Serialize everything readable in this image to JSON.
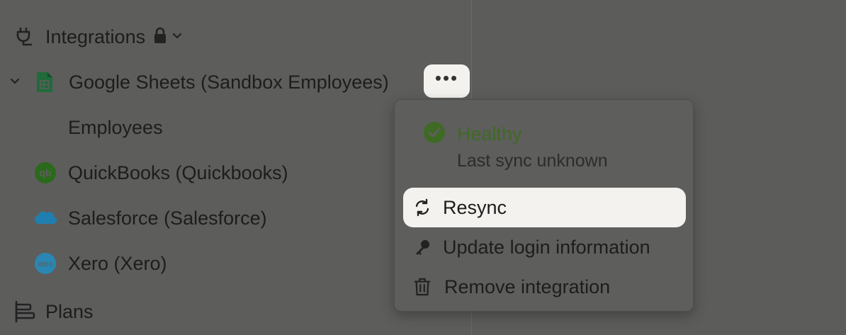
{
  "sidebar": {
    "integrations": {
      "label": "Integrations",
      "icon": "plug-icon"
    },
    "items": [
      {
        "label": "Google Sheets (Sandbox Employees)",
        "icon": "google-sheets-icon",
        "expanded": true
      },
      {
        "label": "Employees"
      },
      {
        "label": "QuickBooks (Quickbooks)",
        "icon": "quickbooks-icon"
      },
      {
        "label": "Salesforce (Salesforce)",
        "icon": "salesforce-icon"
      },
      {
        "label": "Xero (Xero)",
        "icon": "xero-icon"
      }
    ],
    "plans": {
      "label": "Plans",
      "icon": "plans-icon"
    }
  },
  "more_button": {
    "label": "•••"
  },
  "popup": {
    "status": {
      "label": "Healthy",
      "sub": "Last sync unknown",
      "color": "#3f6a24"
    },
    "items": [
      {
        "label": "Resync",
        "icon": "resync-icon",
        "active": true
      },
      {
        "label": "Update login information",
        "icon": "key-icon"
      },
      {
        "label": "Remove integration",
        "icon": "trash-icon"
      }
    ]
  },
  "colors": {
    "overlay_bg": "#5d5d5c",
    "highlight_bg": "#f4f2ee",
    "sheets_green": "#1f6b3a",
    "quickbooks_green": "#2b6a1c",
    "salesforce_blue": "#1f7fb0",
    "xero_blue": "#2a86b2"
  }
}
